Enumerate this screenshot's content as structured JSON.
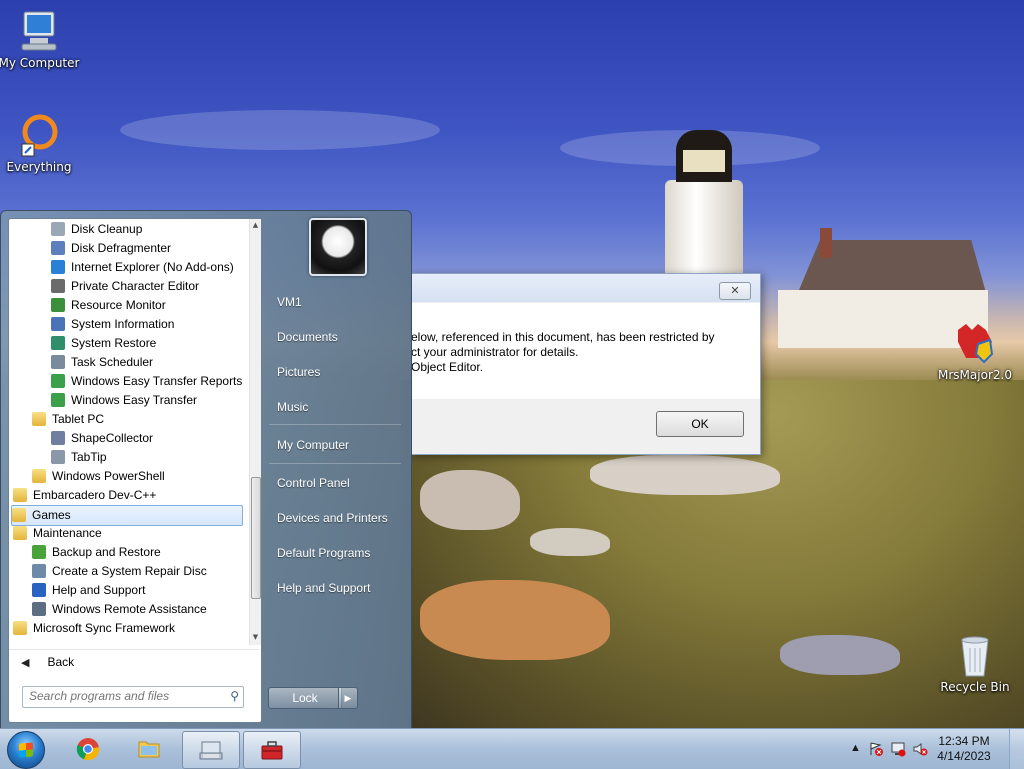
{
  "desktop": {
    "icons": [
      {
        "label": "My Computer",
        "icon": "computer-icon"
      },
      {
        "label": "Everything",
        "icon": "everything-icon"
      },
      {
        "label": "MrsMajor2.0",
        "icon": "mrsmajor-icon"
      },
      {
        "label": "Recycle Bin",
        "icon": "recycle-bin-icon"
      }
    ]
  },
  "dialog": {
    "message": "elow, referenced in this document, has been restricted by\nct your administrator for details.\nObject Editor.",
    "ok_label": "OK",
    "close_glyph": "✕"
  },
  "start_menu": {
    "programs": [
      {
        "label": "Disk Cleanup",
        "level": 2,
        "icon": "disk-cleanup-icon"
      },
      {
        "label": "Disk Defragmenter",
        "level": 2,
        "icon": "disk-defrag-icon"
      },
      {
        "label": "Internet Explorer (No Add-ons)",
        "level": 2,
        "icon": "internet-explorer-icon"
      },
      {
        "label": "Private Character Editor",
        "level": 2,
        "icon": "private-char-editor-icon"
      },
      {
        "label": "Resource Monitor",
        "level": 2,
        "icon": "resource-monitor-icon"
      },
      {
        "label": "System Information",
        "level": 2,
        "icon": "system-information-icon"
      },
      {
        "label": "System Restore",
        "level": 2,
        "icon": "system-restore-icon"
      },
      {
        "label": "Task Scheduler",
        "level": 2,
        "icon": "task-scheduler-icon"
      },
      {
        "label": "Windows Easy Transfer Reports",
        "level": 2,
        "icon": "easy-transfer-reports-icon"
      },
      {
        "label": "Windows Easy Transfer",
        "level": 2,
        "icon": "easy-transfer-icon"
      },
      {
        "label": "Tablet PC",
        "level": 1,
        "icon": "folder-icon"
      },
      {
        "label": "ShapeCollector",
        "level": 2,
        "icon": "shape-collector-icon"
      },
      {
        "label": "TabTip",
        "level": 2,
        "icon": "tabtip-icon"
      },
      {
        "label": "Windows PowerShell",
        "level": 1,
        "icon": "folder-icon"
      },
      {
        "label": "Embarcadero Dev-C++",
        "level": 0,
        "icon": "folder-icon"
      },
      {
        "label": "Games",
        "level": 0,
        "icon": "folder-icon",
        "selected": true
      },
      {
        "label": "Maintenance",
        "level": 0,
        "icon": "folder-icon"
      },
      {
        "label": "Backup and Restore",
        "level": 1,
        "icon": "backup-restore-icon"
      },
      {
        "label": "Create a System Repair Disc",
        "level": 1,
        "icon": "repair-disc-icon"
      },
      {
        "label": "Help and Support",
        "level": 1,
        "icon": "help-icon"
      },
      {
        "label": "Windows Remote Assistance",
        "level": 1,
        "icon": "remote-assistance-icon"
      },
      {
        "label": "Microsoft Sync Framework",
        "level": 0,
        "icon": "folder-icon"
      }
    ],
    "back_label": "Back",
    "search_placeholder": "Search programs and files",
    "right_items": [
      {
        "label": "VM1",
        "name": "user-name-link"
      },
      {
        "label": "Documents",
        "name": "documents-link"
      },
      {
        "label": "Pictures",
        "name": "pictures-link"
      },
      {
        "label": "Music",
        "name": "music-link"
      },
      {
        "label": "My Computer",
        "name": "my-computer-link"
      },
      {
        "label": "Control Panel",
        "name": "control-panel-link"
      },
      {
        "label": "Devices and Printers",
        "name": "devices-printers-link"
      },
      {
        "label": "Default Programs",
        "name": "default-programs-link"
      },
      {
        "label": "Help and Support",
        "name": "help-support-link"
      }
    ],
    "lock_label": "Lock"
  },
  "taskbar": {
    "pinned": [
      {
        "name": "chrome-taskbar-button",
        "icon": "chrome-icon"
      },
      {
        "name": "explorer-taskbar-button",
        "icon": "folder-icon"
      },
      {
        "name": "osk-taskbar-button",
        "icon": "keyboard-icon",
        "active": true
      },
      {
        "name": "toolbox-taskbar-button",
        "icon": "toolbox-icon",
        "active": true
      }
    ],
    "clock_time": "12:34 PM",
    "clock_date": "4/14/2023"
  },
  "colors": {
    "selection_border": "#84acdd",
    "folder": "#e3b43b",
    "taskbar": "#aac0da"
  }
}
